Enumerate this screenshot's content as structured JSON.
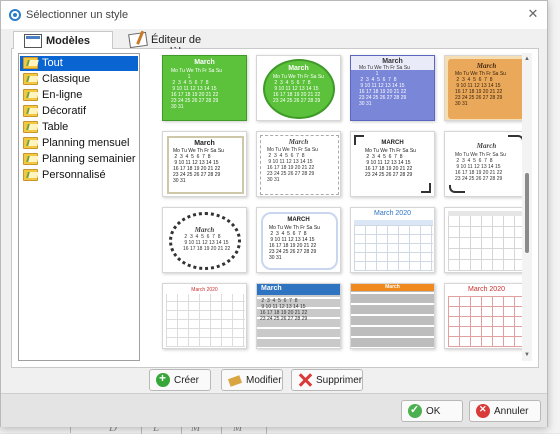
{
  "window": {
    "title": "Sélectionner un style",
    "close_glyph": "✕"
  },
  "tabs": [
    {
      "label": "Modèles",
      "icon": "calendar-models-icon",
      "active": true
    },
    {
      "label": "Éditeur de modèle",
      "icon": "template-editor-icon",
      "active": false
    }
  ],
  "style_list": {
    "items": [
      {
        "label": "Tout",
        "selected": true
      },
      {
        "label": "Classique"
      },
      {
        "label": "En-ligne"
      },
      {
        "label": "Décoratif"
      },
      {
        "label": "Table"
      },
      {
        "label": "Planning mensuel"
      },
      {
        "label": "Planning semainier"
      },
      {
        "label": "Personnalisé"
      }
    ]
  },
  "thumbnails": {
    "month": "March",
    "month_year": "March 2020",
    "month_caps": "MARCH",
    "weekdays": "Mo Tu We Th Fr Sa Su",
    "rows": [
      "            1",
      " 2  3  4  5  6  7  8",
      " 9 10 11 12 13 14 15",
      "16 17 18 19 20 21 22",
      "23 24 25 26 27 28 29",
      "30 31"
    ],
    "colors": {
      "green": "#5cc23b",
      "blue_purple": "#7a86d8",
      "parchment": "#e9a85a",
      "header_blue": "#2f74c0",
      "header_orange": "#f08a1e",
      "header_red": "#c9302c"
    }
  },
  "actions": {
    "create": "Créer",
    "modify": "Modifier",
    "delete": "Supprimer"
  },
  "footer": {
    "ok": "OK",
    "cancel": "Annuler"
  },
  "background": {
    "letters": [
      "D",
      "L",
      "M",
      "M"
    ]
  }
}
